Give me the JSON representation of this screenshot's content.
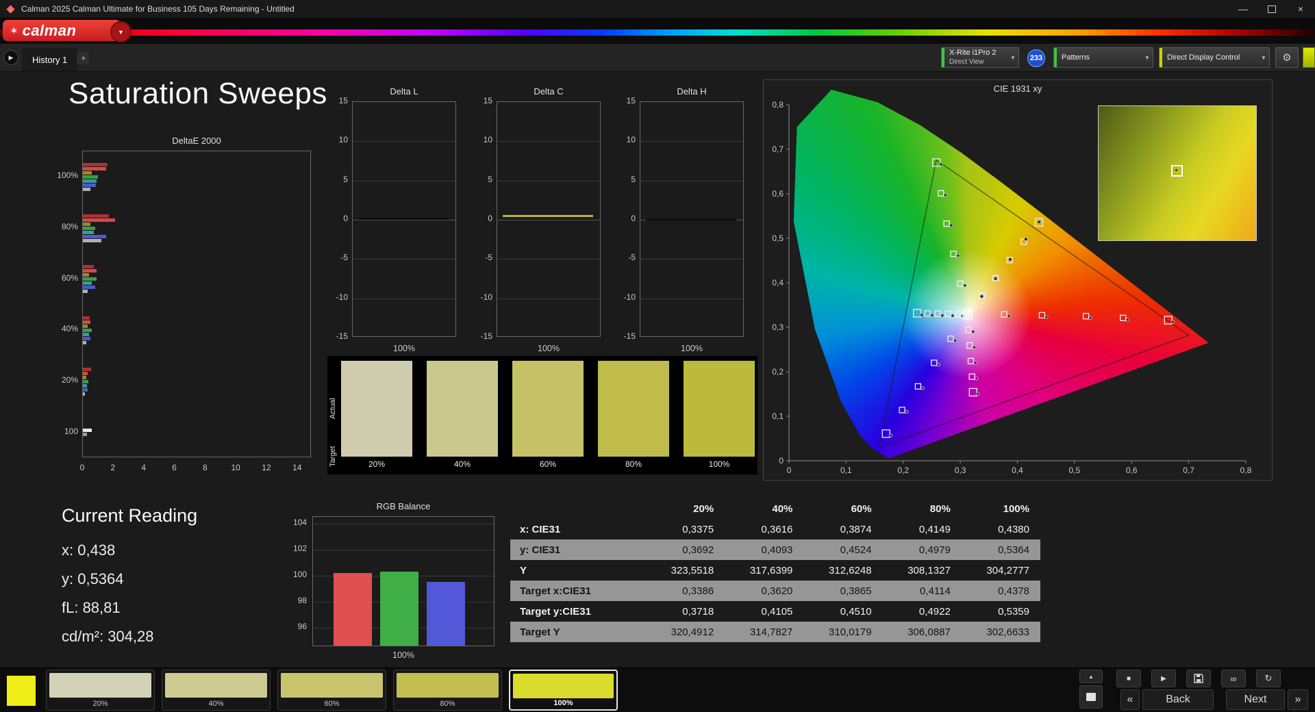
{
  "window": {
    "title": "Calman 2025 Calman Ultimate for Business 105 Days Remaining  - Untitled"
  },
  "brand": {
    "logo_text": "calman"
  },
  "tabs": {
    "history_label": "History 1",
    "add_label": "+"
  },
  "toolbar": {
    "meter": {
      "line1": "X-Rite i1Pro 2",
      "line2": "Direct View"
    },
    "badge": "233",
    "patterns_label": "Patterns",
    "ddc_label": "Direct Display Control"
  },
  "page": {
    "title": "Saturation Sweeps"
  },
  "current_reading": {
    "title": "Current Reading",
    "lines": [
      "x: 0,438",
      "y: 0,5364",
      "fL: 88,81",
      "cd/m²: 304,28"
    ]
  },
  "charts": {
    "deltae": {
      "type": "bar",
      "title": "DeltaE 2000",
      "categories": [
        "100%",
        "80%",
        "60%",
        "40%",
        "20%",
        "100"
      ],
      "xticks": [
        0,
        2,
        4,
        6,
        8,
        10,
        12,
        14
      ],
      "xmax": 14.9,
      "bar_colors": [
        "#a83232",
        "#d84848",
        "#9a8a2a",
        "#3f9b4a",
        "#3a9b9b",
        "#4a5bd0",
        "#b0b0b0"
      ],
      "last_group_colors": [
        "#e8e8e8",
        "#9a9a9a"
      ],
      "groups": [
        [
          1.6,
          1.5,
          0.6,
          1.0,
          0.9,
          0.85,
          0.5
        ],
        [
          1.7,
          2.1,
          0.5,
          0.8,
          0.7,
          1.5,
          1.2
        ],
        [
          0.7,
          0.9,
          0.4,
          0.9,
          0.6,
          0.8,
          0.3
        ],
        [
          0.45,
          0.5,
          0.3,
          0.6,
          0.4,
          0.5,
          0.2
        ],
        [
          0.55,
          0.3,
          0.2,
          0.35,
          0.25,
          0.3,
          0.15
        ],
        [
          0.6,
          0.25
        ]
      ]
    },
    "delta_yticks": [
      15,
      10,
      5,
      0,
      -5,
      -10,
      -15
    ],
    "delta_xlabel": "100%",
    "delta_charts": [
      {
        "title": "Delta L",
        "value": 0.15,
        "color": "#0d0d0d"
      },
      {
        "title": "Delta C",
        "value": 0.5,
        "color": "#b6b62e"
      },
      {
        "title": "Delta H",
        "value": 0.1,
        "color": "#101010"
      }
    ],
    "cie": {
      "type": "scatter",
      "title": "CIE 1931 xy",
      "xticks": [
        "0",
        "0,1",
        "0,2",
        "0,3",
        "0,4",
        "0,5",
        "0,6",
        "0,7",
        "0,8"
      ],
      "yticks": [
        "0",
        "0,1",
        "0,2",
        "0,3",
        "0,4",
        "0,5",
        "0,6",
        "0,7",
        "0,8"
      ],
      "triangle": [
        [
          0.258,
          0.676
        ],
        [
          0.7,
          0.282
        ],
        [
          0.158,
          0.03
        ]
      ],
      "white_point": [
        0.3127,
        0.329
      ],
      "sweeps": {
        "yellow_target": [
          [
            0.3386,
            0.3718
          ],
          [
            0.362,
            0.4105
          ],
          [
            0.3865,
            0.451
          ],
          [
            0.4114,
            0.4922
          ],
          [
            0.4378,
            0.5359
          ]
        ],
        "yellow_measured": [
          [
            0.3375,
            0.3692
          ],
          [
            0.3616,
            0.4093
          ],
          [
            0.3874,
            0.4524
          ],
          [
            0.4149,
            0.4979
          ],
          [
            0.438,
            0.5364
          ]
        ],
        "red_target": [
          [
            0.377,
            0.329
          ],
          [
            0.443,
            0.327
          ],
          [
            0.52,
            0.325
          ],
          [
            0.585,
            0.321
          ],
          [
            0.664,
            0.316
          ]
        ],
        "green_target": [
          [
            0.3,
            0.398
          ],
          [
            0.288,
            0.465
          ],
          [
            0.276,
            0.533
          ],
          [
            0.266,
            0.601
          ],
          [
            0.258,
            0.67
          ]
        ],
        "blue_target": [
          [
            0.283,
            0.274
          ],
          [
            0.254,
            0.22
          ],
          [
            0.226,
            0.167
          ],
          [
            0.198,
            0.114
          ],
          [
            0.17,
            0.061
          ]
        ],
        "cyan_target": [
          [
            0.296,
            0.3295
          ],
          [
            0.2785,
            0.33
          ],
          [
            0.2605,
            0.3305
          ],
          [
            0.2425,
            0.331
          ],
          [
            0.2245,
            0.3315
          ]
        ],
        "magenta_target": [
          [
            0.3143,
            0.294
          ],
          [
            0.3163,
            0.259
          ],
          [
            0.3184,
            0.224
          ],
          [
            0.3204,
            0.189
          ],
          [
            0.3224,
            0.154
          ]
        ]
      }
    },
    "rgb_balance": {
      "type": "bar",
      "title": "RGB Balance",
      "yticks": [
        104,
        102,
        100,
        98,
        96
      ],
      "range": [
        94.5,
        104.5
      ],
      "bars": [
        {
          "name": "red",
          "value": 100.1,
          "color": "#e05050"
        },
        {
          "name": "green",
          "value": 100.2,
          "color": "#3fae46"
        },
        {
          "name": "blue",
          "value": 99.4,
          "color": "#5258d8"
        }
      ],
      "xlabel": "100%"
    }
  },
  "swatch_panel": {
    "row_labels": [
      "Actual",
      "Target"
    ],
    "columns": [
      {
        "label": "20%",
        "color": "#cfcdae"
      },
      {
        "label": "40%",
        "color": "#cbc88e"
      },
      {
        "label": "60%",
        "color": "#c5c268"
      },
      {
        "label": "80%",
        "color": "#bfbc4c"
      },
      {
        "label": "100%",
        "color": "#bcba3a"
      }
    ]
  },
  "table": {
    "headers": [
      "20%",
      "40%",
      "60%",
      "80%",
      "100%"
    ],
    "rows": [
      {
        "label": "x: CIE31",
        "values": [
          "0,3375",
          "0,3616",
          "0,3874",
          "0,4149",
          "0,4380"
        ]
      },
      {
        "label": "y: CIE31",
        "values": [
          "0,3692",
          "0,4093",
          "0,4524",
          "0,4979",
          "0,5364"
        ]
      },
      {
        "label": "Y",
        "values": [
          "323,5518",
          "317,6399",
          "312,6248",
          "308,1327",
          "304,2777"
        ]
      },
      {
        "label": "Target x:CIE31",
        "values": [
          "0,3386",
          "0,3620",
          "0,3865",
          "0,4114",
          "0,4378"
        ]
      },
      {
        "label": "Target y:CIE31",
        "values": [
          "0,3718",
          "0,4105",
          "0,4510",
          "0,4922",
          "0,5359"
        ]
      },
      {
        "label": "Target Y",
        "values": [
          "320,4912",
          "314,7827",
          "310,0179",
          "306,0887",
          "302,6633"
        ]
      }
    ]
  },
  "bottom_bar": {
    "preview_color": "#f0ee18",
    "swatches": [
      {
        "label": "20%",
        "color": "#d3d1b6",
        "selected": false
      },
      {
        "label": "40%",
        "color": "#cecb92",
        "selected": false
      },
      {
        "label": "60%",
        "color": "#c8c56e",
        "selected": false
      },
      {
        "label": "80%",
        "color": "#c2bf50",
        "selected": false
      },
      {
        "label": "100%",
        "color": "#dbdb2e",
        "selected": true
      }
    ],
    "buttons": {
      "back": "Back",
      "next": "Next"
    }
  }
}
